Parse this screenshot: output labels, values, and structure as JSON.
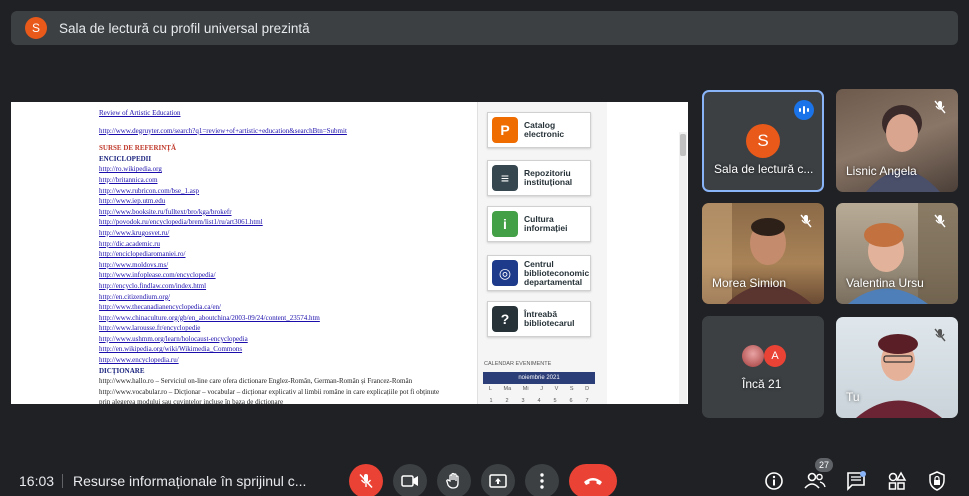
{
  "presenting": {
    "avatar_letter": "S",
    "avatar_color": "#e8591a",
    "text": "Sala de lectură cu profil universal prezintă"
  },
  "shared_doc": {
    "lines": [
      {
        "text": "Review of Artistic Education",
        "style": "link"
      },
      {
        "text": "",
        "style": "gap"
      },
      {
        "text": "http://www.degruyter.com/search?q1=review+of+artistic+education&searchBtn=Submit",
        "style": "link"
      },
      {
        "text": "",
        "style": "gap"
      },
      {
        "text": "SURSE DE REFERINȚĂ",
        "style": "red"
      },
      {
        "text": "ENCICLOPEDII",
        "style": "blue"
      },
      {
        "text": "http://ro.wikipedia.org",
        "style": "link"
      },
      {
        "text": "http://britannica.com",
        "style": "link"
      },
      {
        "text": "http://www.rubricon.com/bse_1.asp",
        "style": "link"
      },
      {
        "text": "http://www.iep.utm.edu",
        "style": "link"
      },
      {
        "text": "http://www.booksite.ru/fulltext/bro/kga/brokefr",
        "style": "link"
      },
      {
        "text": "http://povodok.ru/encyclopedia/brem/list1/ru/art3061.html",
        "style": "link"
      },
      {
        "text": "http://www.krugosvet.ru/",
        "style": "link"
      },
      {
        "text": "http://dic.academic.ru",
        "style": "link"
      },
      {
        "text": "http://enciclopediaromaniei.ro/",
        "style": "link"
      },
      {
        "text": "http://www.moldovs.ms/",
        "style": "link"
      },
      {
        "text": "http://www.infoplease.com/encyclopedia/",
        "style": "link"
      },
      {
        "text": "http://encyclo.findlaw.com/index.html",
        "style": "link"
      },
      {
        "text": "http://en.citizendium.org/",
        "style": "link"
      },
      {
        "text": "http://www.thecanadianencyclopedia.ca/en/",
        "style": "link"
      },
      {
        "text": "http://www.chinaculture.org/gb/en_aboutchina/2003-09/24/content_23574.htm",
        "style": "link"
      },
      {
        "text": "http://www.larousse.fr/encyclopedie",
        "style": "link"
      },
      {
        "text": "http://www.ushmm.org/learn/holocaust-encyclopedia",
        "style": "link"
      },
      {
        "text": "http://en.wikipedia.org/wiki/Wikimedia_Commons",
        "style": "link"
      },
      {
        "text": "http://www.encyclopedia.ru/",
        "style": "link"
      },
      {
        "text": "DICȚIONARE",
        "style": "blue"
      },
      {
        "text": "http://www.hallo.ro – Serviciul on-line care ofera dictionare Englez-Român, German-Român și Francez-Român",
        "style": "mixed"
      },
      {
        "text": "http://www.vocabular.ro – Dicționar – vocabular – dicționar explicativ al limbii române in care explicațiile pot fi obținute",
        "style": "mixed"
      },
      {
        "text": "prin alegerea modului sau cuvintelor incluse în baza de dicționare",
        "style": "plain"
      }
    ],
    "cards": [
      {
        "label": "Catalog electronic",
        "icon": "primo-icon",
        "glyph": "P",
        "color": "#ef6c00"
      },
      {
        "label": "Repozitoriu instituțional",
        "icon": "layers-icon",
        "glyph": "≡",
        "color": "#37474f"
      },
      {
        "label": "Cultura informației",
        "icon": "info-icon",
        "glyph": "i",
        "color": "#43a047"
      },
      {
        "label": "Centrul biblioteconomic departamental",
        "icon": "scan-icon",
        "glyph": "◎",
        "color": "#1e3a8a"
      },
      {
        "label": "Întreabă bibliotecarul",
        "icon": "question-icon",
        "glyph": "?",
        "color": "#263238"
      }
    ],
    "calendar": {
      "title": "CALENDAR EVENIMENTE",
      "month": "noiembrie 2021",
      "days": [
        "L",
        "Ma",
        "Mi",
        "J",
        "V",
        "S",
        "D"
      ],
      "week1": [
        "1",
        "2",
        "3",
        "4",
        "5",
        "6",
        "7"
      ]
    }
  },
  "participants": [
    {
      "name": "Sala de lectură c...",
      "avatar": "S",
      "avatar_color": "#e8591a",
      "speaking": true
    },
    {
      "name": "Lisnic Angela",
      "muted": true
    },
    {
      "name": "Morea Simion",
      "muted": true
    },
    {
      "name": "Valentina Ursu",
      "muted": true
    },
    {
      "name": "Încă 21",
      "avatar": "A",
      "avatar_color": "#ea4335"
    },
    {
      "name": "Tu",
      "muted": true
    }
  ],
  "bottom": {
    "time": "16:03",
    "meeting_title": "Resurse informaționale în sprijinul c...",
    "people_count": "27"
  },
  "colors": {
    "accent_blue": "#1a73e8",
    "danger_red": "#ea4335",
    "surface": "#3c4043",
    "background": "#202124"
  }
}
